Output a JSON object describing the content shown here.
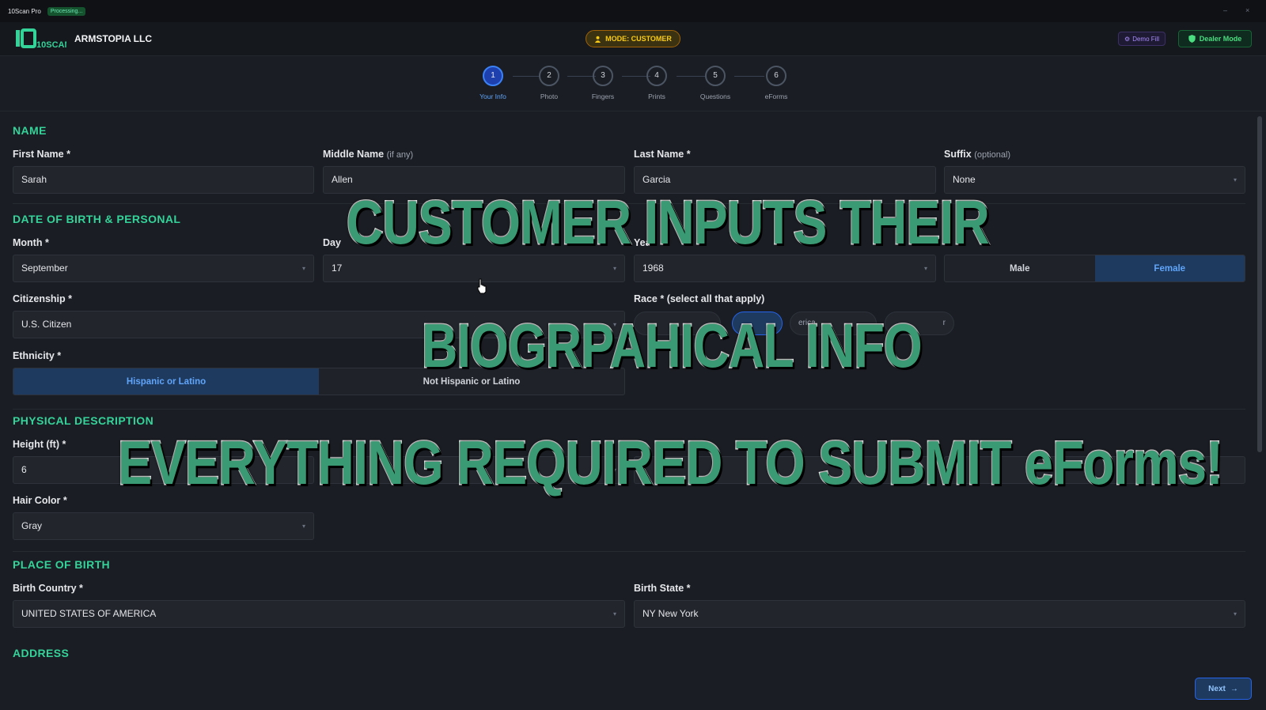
{
  "window": {
    "app_name": "10Scan Pro",
    "status": "Processing...",
    "controls": [
      "–",
      "×"
    ]
  },
  "header": {
    "logo_text": "10SCAN",
    "company": "ARMSTOPIA LLC",
    "mode_label": "MODE: CUSTOMER",
    "demo_fill": "Demo Fill",
    "dealer_mode": "Dealer Mode"
  },
  "steps": [
    {
      "num": "1",
      "label": "Your Info"
    },
    {
      "num": "2",
      "label": "Photo"
    },
    {
      "num": "3",
      "label": "Fingers"
    },
    {
      "num": "4",
      "label": "Prints"
    },
    {
      "num": "5",
      "label": "Questions"
    },
    {
      "num": "6",
      "label": "eForms"
    }
  ],
  "active_step": 1,
  "form": {
    "name_section": "NAME",
    "first_name": {
      "label": "First Name *",
      "value": "Sarah"
    },
    "middle_name": {
      "label": "Middle Name",
      "hint": "(if any)",
      "value": "Allen"
    },
    "last_name": {
      "label": "Last Name *",
      "value": "Garcia"
    },
    "suffix": {
      "label": "Suffix",
      "hint": "(optional)",
      "value": "None"
    },
    "dob_section": "DATE OF BIRTH & PERSONAL",
    "month": {
      "label": "Month *",
      "value": "September"
    },
    "day": {
      "label": "Day",
      "value": "17"
    },
    "year": {
      "label": "Yea",
      "value": "1968"
    },
    "sex": {
      "options": [
        "Male",
        "Female"
      ],
      "selected": "Female"
    },
    "citizenship": {
      "label": "Citizenship *",
      "value": "U.S. Citizen"
    },
    "race": {
      "label": "Race * (select all that apply)",
      "visible_fragments": [
        "erica",
        "r"
      ]
    },
    "ethnicity": {
      "label": "Ethnicity *",
      "options": [
        "Hispanic or Latino",
        "Not Hispanic or Latino"
      ],
      "selected": "Hispanic or Latino"
    },
    "physical_section": "PHYSICAL DESCRIPTION",
    "height_ft": {
      "label": "Height (ft) *",
      "value": "6"
    },
    "hair_color": {
      "label": "Hair Color *",
      "value": "Gray"
    },
    "pob_section": "PLACE OF BIRTH",
    "birth_country": {
      "label": "Birth Country *",
      "value": "UNITED STATES OF AMERICA"
    },
    "birth_state": {
      "label": "Birth State *",
      "value": "NY New York"
    },
    "address_section": "ADDRESS"
  },
  "footer": {
    "next": "Next"
  },
  "overlay": {
    "line1": "CUSTOMER INPUTS THEIR",
    "line2": "BIOGRPAHICAL INFO",
    "line3": "EVERYTHING REQUIRED TO SUBMIT eForms!"
  },
  "colors": {
    "accent_green": "#34d399",
    "caption_fill": "#3a9a73",
    "mode_yellow": "#facc15",
    "selected_blue": "#1e3a5f"
  },
  "icons": [
    "person-icon",
    "chevron-down-icon",
    "shield-icon",
    "sparkle-icon",
    "arrow-right-icon",
    "pointer-cursor-icon"
  ]
}
